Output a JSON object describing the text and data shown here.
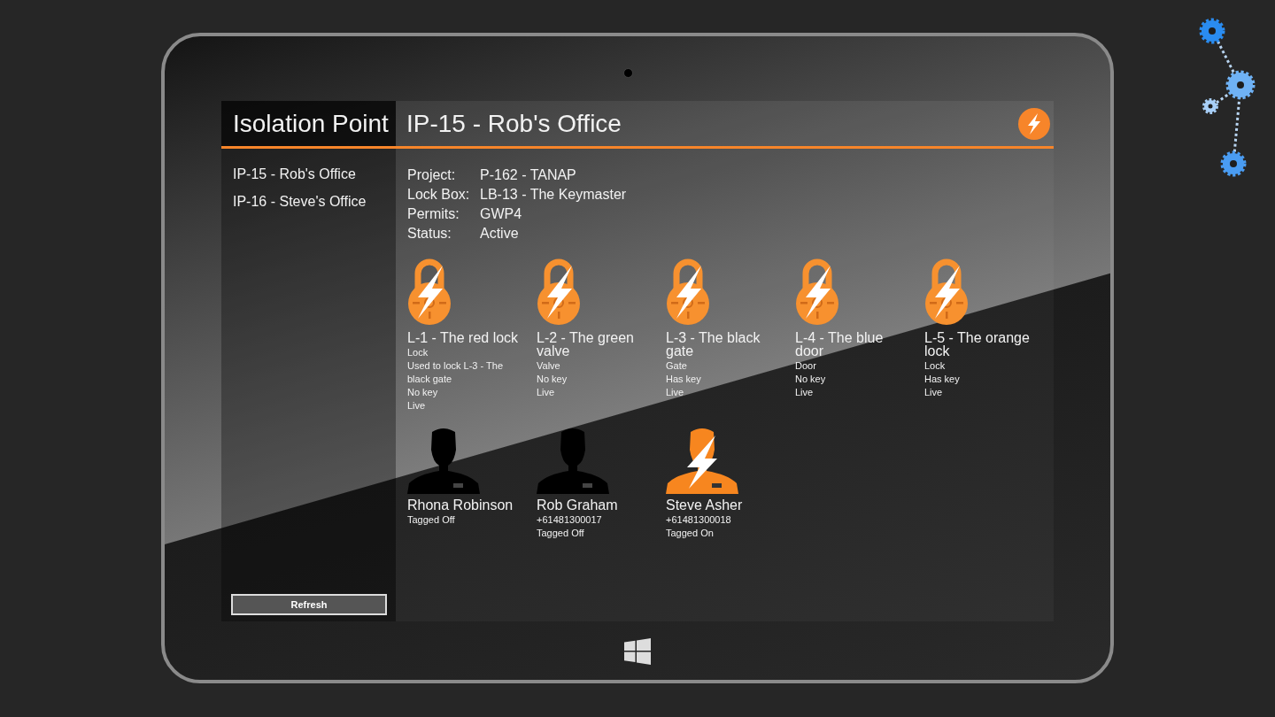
{
  "sidebar": {
    "title": "Isolation Point",
    "items": [
      {
        "label": "IP-15 - Rob's Office"
      },
      {
        "label": "IP-16 - Steve's Office"
      }
    ],
    "refresh_button": "Refresh"
  },
  "header": {
    "title": "IP-15 - Rob's Office"
  },
  "details": [
    {
      "label": "Project:",
      "value": "P-162 - TANAP"
    },
    {
      "label": "Lock Box:",
      "value": "LB-13 - The Keymaster"
    },
    {
      "label": "Permits:",
      "value": "GWP4"
    },
    {
      "label": "Status:",
      "value": "Active"
    }
  ],
  "locks": [
    {
      "title": "L-1 - The red lock",
      "lines": [
        "Lock",
        "Used to lock L-3 - The black gate",
        "No key",
        "Live"
      ]
    },
    {
      "title": "L-2 - The green valve",
      "lines": [
        "Valve",
        "No key",
        "Live"
      ]
    },
    {
      "title": "L-3 - The black gate",
      "lines": [
        "Gate",
        "Has key",
        "Live"
      ]
    },
    {
      "title": "L-4 - The blue door",
      "lines": [
        "Door",
        "No key",
        "Live"
      ]
    },
    {
      "title": "L-5 - The orange lock",
      "lines": [
        "Lock",
        "Has key",
        "Live"
      ]
    }
  ],
  "people": [
    {
      "name": "Rhona Robinson",
      "lines": [
        "Tagged Off"
      ],
      "tagged_on": false
    },
    {
      "name": "Rob Graham",
      "lines": [
        "+61481300017",
        "Tagged Off"
      ],
      "tagged_on": false
    },
    {
      "name": "Steve Asher",
      "lines": [
        "+61481300018",
        "Tagged On"
      ],
      "tagged_on": true
    }
  ]
}
